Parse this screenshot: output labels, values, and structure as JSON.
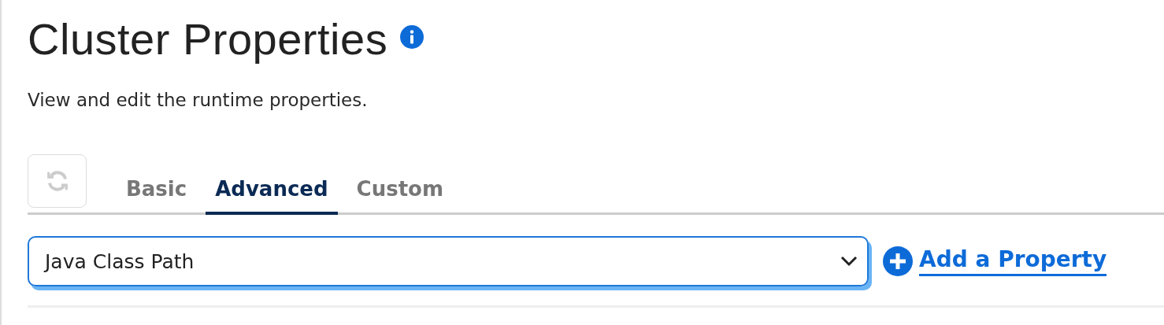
{
  "title": "Cluster Properties",
  "subtitle": "View and edit the runtime properties.",
  "refresh_button": {
    "disabled": true
  },
  "tabs": [
    {
      "label": "Basic",
      "selected": false
    },
    {
      "label": "Advanced",
      "selected": true
    },
    {
      "label": "Custom",
      "selected": false
    }
  ],
  "property_select": {
    "value": "Java Class Path",
    "focused": true
  },
  "add_link": "Add a Property"
}
